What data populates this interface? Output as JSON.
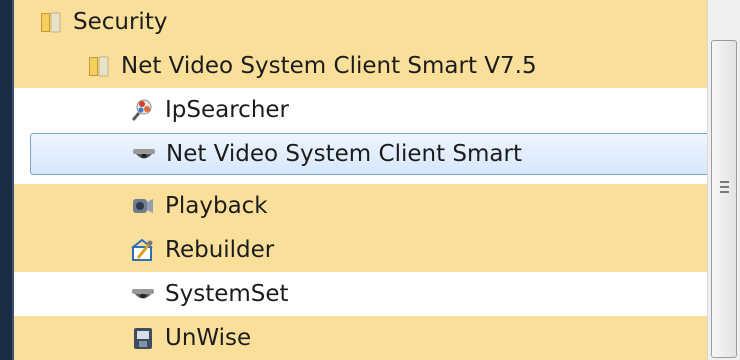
{
  "tree": {
    "items": [
      {
        "label": "Security",
        "icon": "folder-icon",
        "level": 0,
        "state": "highlighted"
      },
      {
        "label": "Net Video System Client Smart V7.5",
        "icon": "folder-icon",
        "level": 1,
        "state": "highlighted"
      },
      {
        "label": "IpSearcher",
        "icon": "ipsearcher-icon",
        "level": 2,
        "state": "normal"
      },
      {
        "label": "Net Video System Client Smart",
        "icon": "dome-camera-icon",
        "level": 2,
        "state": "selected"
      },
      {
        "label": "Playback",
        "icon": "playback-camera-icon",
        "level": 2,
        "state": "highlighted"
      },
      {
        "label": "Rebuilder",
        "icon": "rebuilder-icon",
        "level": 2,
        "state": "highlighted"
      },
      {
        "label": "SystemSet",
        "icon": "dome-camera-icon",
        "level": 2,
        "state": "normal"
      },
      {
        "label": "UnWise",
        "icon": "uninstall-icon",
        "level": 2,
        "state": "highlighted"
      }
    ]
  },
  "colors": {
    "highlight": "#f9df9a",
    "selection": "#d6e7fb",
    "selection_border": "#7da2ce"
  }
}
